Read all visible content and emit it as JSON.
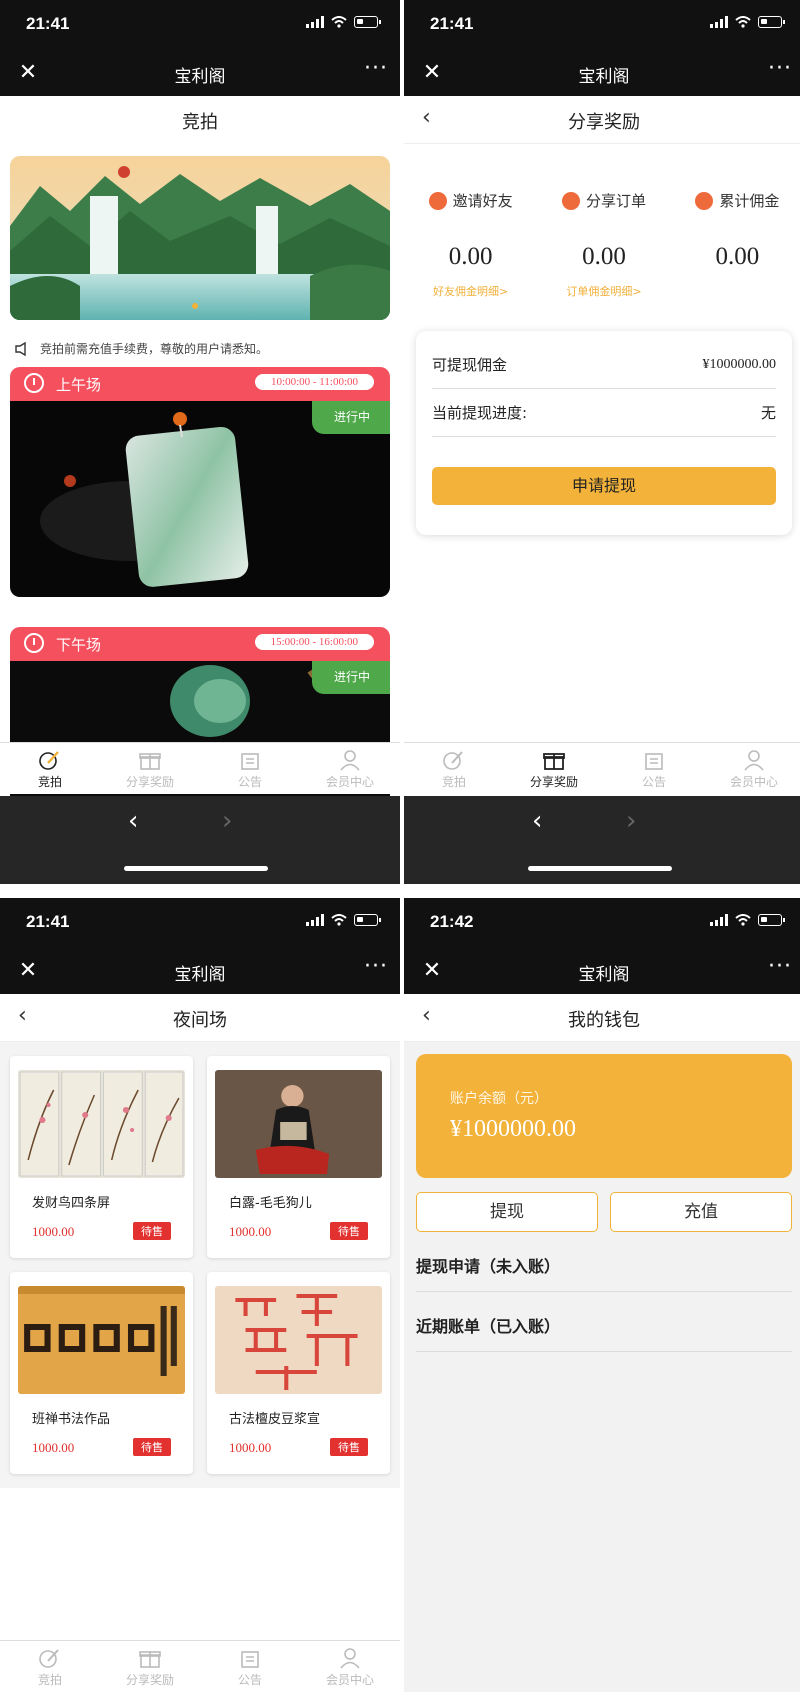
{
  "app": {
    "time": "21:41",
    "time_p4": "21:42",
    "title": "宝利阁"
  },
  "colors": {
    "accent": "#f3b23a",
    "session_red": "#f5505e",
    "live_green": "#4fa84a",
    "price_red": "#e2312f"
  },
  "tabs": [
    "竞拍",
    "分享奖励",
    "公告",
    "会员中心"
  ],
  "auction": {
    "page_title": "竞拍",
    "notice": "竞拍前需充值手续费，尊敬的用户请悉知。",
    "sessions": [
      {
        "name": "上午场",
        "time": "10:00:00 - 11:00:00",
        "status": "进行中"
      },
      {
        "name": "下午场",
        "time": "15:00:00 - 16:00:00",
        "status": "进行中"
      }
    ]
  },
  "share": {
    "page_title": "分享奖励",
    "cols": [
      {
        "label": "邀请好友",
        "value": "0.00",
        "link": "好友佣金明细>"
      },
      {
        "label": "分享订单",
        "value": "0.00",
        "link": "订单佣金明细>"
      },
      {
        "label": "累计佣金",
        "value": "0.00",
        "link": ""
      }
    ],
    "withdrawable_label": "可提现佣金",
    "withdrawable_value": "¥1000000.00",
    "progress_label": "当前提现进度:",
    "progress_value": "无",
    "apply_button": "申请提现"
  },
  "night": {
    "page_title": "夜间场",
    "products": [
      {
        "name": "发财鸟四条屏",
        "price": "1000.00",
        "badge": "待售"
      },
      {
        "name": "白露-毛毛狗儿",
        "price": "1000.00",
        "badge": "待售"
      },
      {
        "name": "班禅书法作品",
        "price": "1000.00",
        "badge": "待售"
      },
      {
        "name": "古法檀皮豆浆宣",
        "price": "1000.00",
        "badge": "待售"
      }
    ]
  },
  "wallet": {
    "page_title": "我的钱包",
    "balance_label": "账户余额（元）",
    "balance_value": "¥1000000.00",
    "withdraw_button": "提现",
    "recharge_button": "充值",
    "section1": "提现申请（未入账）",
    "section2": "近期账单（已入账）"
  }
}
